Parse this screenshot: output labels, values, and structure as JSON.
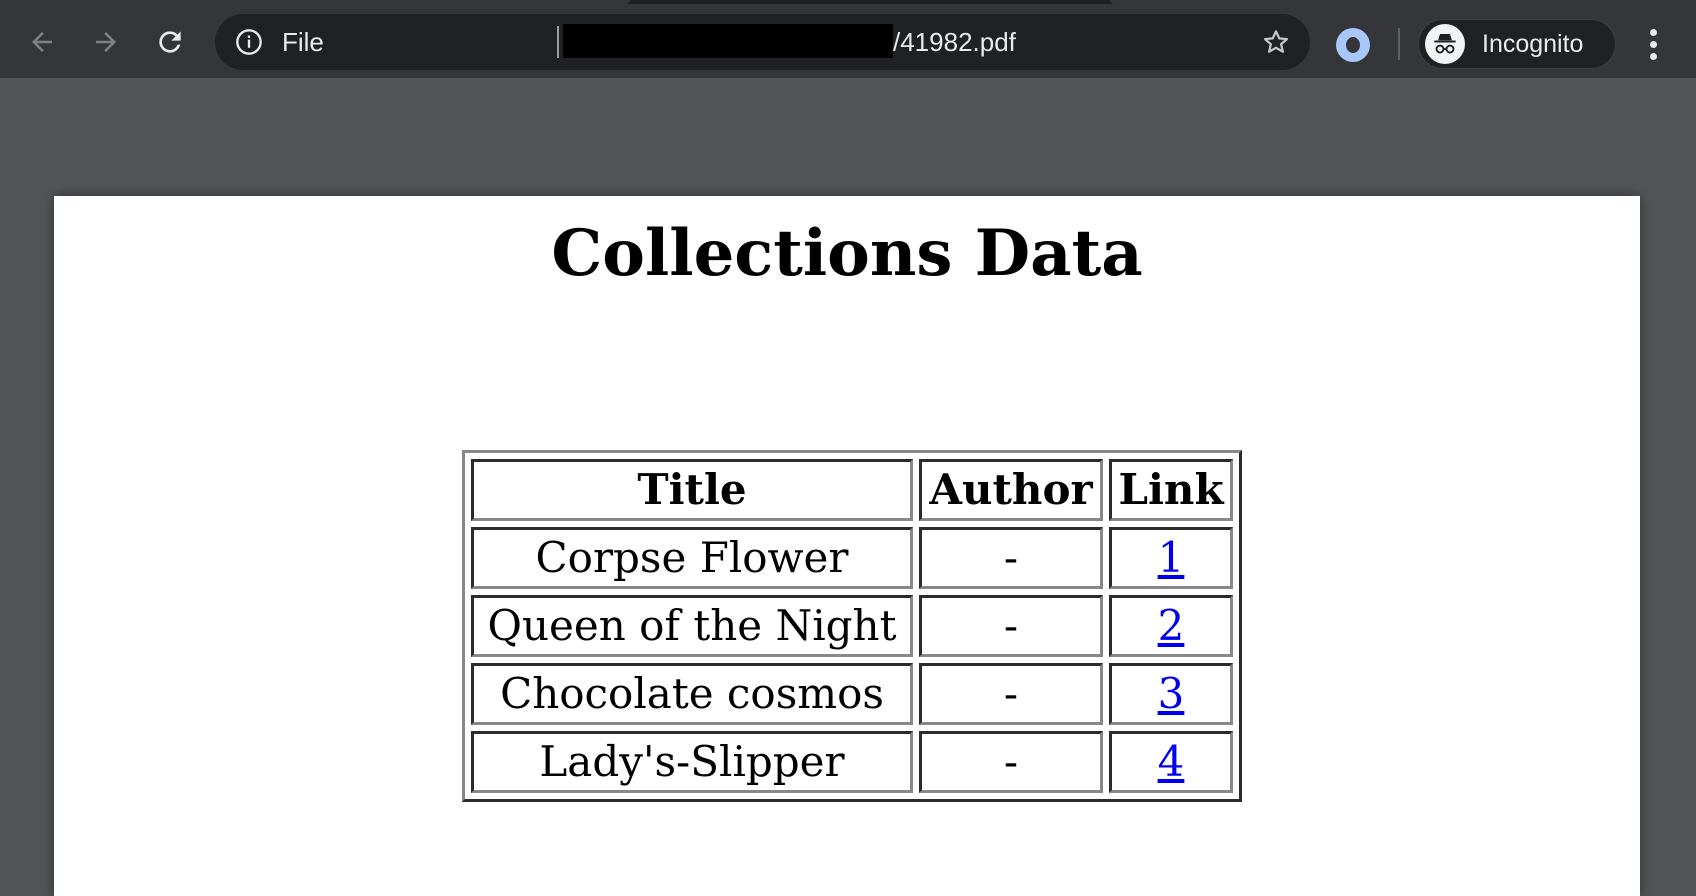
{
  "browser": {
    "url_scheme_label": "File",
    "url_visible_path": "/41982.pdf",
    "profile_label": "Incognito",
    "icons": {
      "back": "arrow-left-icon",
      "forward": "arrow-right-icon",
      "reload": "reload-icon",
      "site_info": "info-icon",
      "bookmark": "star-icon",
      "extension": "extension-ring-icon",
      "incognito": "incognito-icon",
      "menu": "kebab-menu-icon"
    },
    "colors": {
      "toolbar": "#35363a",
      "omnibox": "#202124",
      "viewer_bg": "#525659",
      "extension_accent": "#a8c7fa"
    }
  },
  "document": {
    "title": "Collections Data",
    "table": {
      "headers": [
        "Title",
        "Author",
        "Link"
      ],
      "rows": [
        {
          "title": "Corpse Flower",
          "author": "-",
          "link": "1"
        },
        {
          "title": "Queen of the Night",
          "author": "-",
          "link": "2"
        },
        {
          "title": "Chocolate cosmos",
          "author": "-",
          "link": "3"
        },
        {
          "title": "Lady's-Slipper",
          "author": "-",
          "link": "4"
        }
      ]
    },
    "colors": {
      "link": "#0000ee",
      "text": "#000000",
      "page": "#ffffff"
    }
  }
}
